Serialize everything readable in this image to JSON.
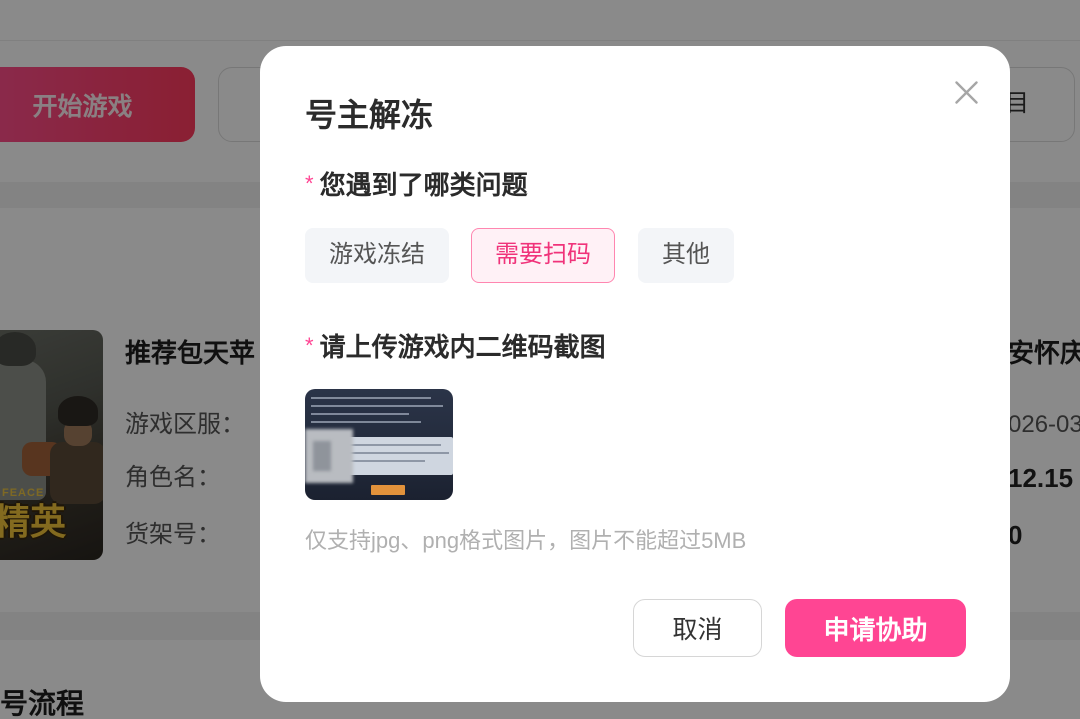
{
  "background": {
    "start_button_label": "开始游戏",
    "right_button_fragment": "目",
    "listing": {
      "title": "推荐包天苹",
      "field_labels": [
        "游戏区服：",
        "角色名：",
        "货架号："
      ],
      "right_title_fragment": "安怀庆",
      "right_value_fragments": [
        "026-03",
        "12.15",
        "0"
      ],
      "cover_logo_sub": "FEACE",
      "cover_logo": "精英"
    },
    "section_title_fragment": "号流程"
  },
  "dialog": {
    "title": "号主解冻",
    "close_icon": "close-icon",
    "question": {
      "required_mark": "*",
      "label": "您遇到了哪类问题",
      "options": [
        {
          "label": "游戏冻结",
          "selected": false
        },
        {
          "label": "需要扫码",
          "selected": true
        },
        {
          "label": "其他",
          "selected": false
        }
      ]
    },
    "upload": {
      "required_mark": "*",
      "label": "请上传游戏内二维码截图",
      "has_uploaded_image": true,
      "hint": "仅支持jpg、png格式图片，图片不能超过5MB"
    },
    "cancel_label": "取消",
    "submit_label": "申请协助"
  },
  "colors": {
    "accent": "#ff4593",
    "start_button": "#ff4d8a",
    "option_bg": "#f3f5f8",
    "selected_option_bg": "#fff1f6",
    "selected_option_border": "#ff86b0",
    "selected_option_text": "#f0337a"
  }
}
